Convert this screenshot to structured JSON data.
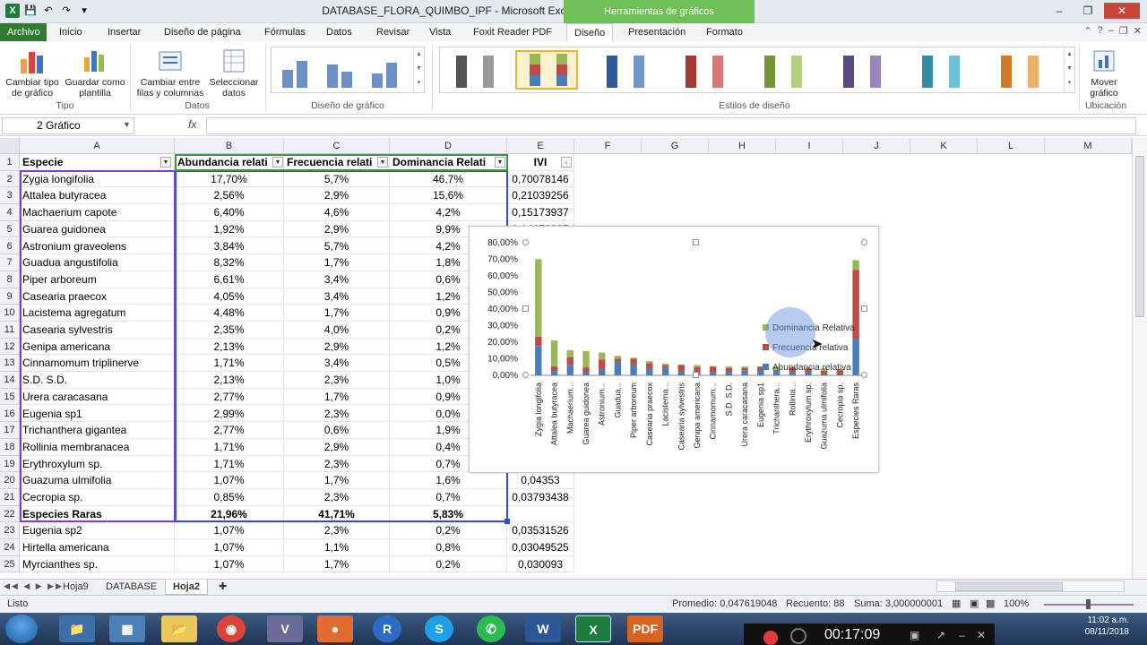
{
  "window": {
    "title": "DATABASE_FLORA_QUIMBO_IPF - Microsoft Excel",
    "tools_banner": "Herramientas de gráficos"
  },
  "ribbon_tabs": [
    "Archivo",
    "Inicio",
    "Insertar",
    "Diseño de página",
    "Fórmulas",
    "Datos",
    "Revisar",
    "Vista",
    "Foxit Reader PDF",
    "Diseño",
    "Presentación",
    "Formato"
  ],
  "ribbon": {
    "cambiar_tipo": "Cambiar tipo de gráfico",
    "guardar_plantilla": "Guardar como plantilla",
    "grupo_tipo": "Tipo",
    "cambiar_filas": "Cambiar entre filas y columnas",
    "seleccionar_datos": "Seleccionar datos",
    "grupo_datos": "Datos",
    "grupo_diseno": "Diseño de gráfico",
    "grupo_estilos": "Estilos de diseño",
    "mover_grafico": "Mover gráfico",
    "grupo_ubicacion": "Ubicación"
  },
  "formula_bar": {
    "name_box": "2 Gráfico",
    "fx": "fx",
    "value": ""
  },
  "columns": [
    "A",
    "B",
    "C",
    "D",
    "E",
    "F",
    "G",
    "H",
    "I",
    "J",
    "K",
    "L",
    "M"
  ],
  "headers": {
    "a": "Especie",
    "b": "Abundancia relati",
    "c": "Frecuencia relati",
    "d": "Dominancia Relati",
    "e": "IVI"
  },
  "rows": [
    {
      "n": "2",
      "a": "Zygia longifolia",
      "b": "17,70%",
      "c": "5,7%",
      "d": "46,7%",
      "e": "0,70078146"
    },
    {
      "n": "3",
      "a": "Attalea butyracea",
      "b": "2,56%",
      "c": "2,9%",
      "d": "15,6%",
      "e": "0,21039256"
    },
    {
      "n": "4",
      "a": "Machaerium capote",
      "b": "6,40%",
      "c": "4,6%",
      "d": "4,2%",
      "e": "0,15173937"
    },
    {
      "n": "5",
      "a": "Guarea guidonea",
      "b": "1,92%",
      "c": "2,9%",
      "d": "9,9%",
      "e": "0,14672987"
    },
    {
      "n": "6",
      "a": "Astronium graveolens",
      "b": "3,84%",
      "c": "5,7%",
      "d": "4,2%",
      "e": ""
    },
    {
      "n": "7",
      "a": "Guadua angustifolia",
      "b": "8,32%",
      "c": "1,7%",
      "d": "1,8%",
      "e": ""
    },
    {
      "n": "8",
      "a": "Piper arboreum",
      "b": "6,61%",
      "c": "3,4%",
      "d": "0,6%",
      "e": ""
    },
    {
      "n": "9",
      "a": "Casearia praecox",
      "b": "4,05%",
      "c": "3,4%",
      "d": "1,2%",
      "e": ""
    },
    {
      "n": "10",
      "a": "Lacistema agregatum",
      "b": "4,48%",
      "c": "1,7%",
      "d": "0,9%",
      "e": ""
    },
    {
      "n": "11",
      "a": "Casearia sylvestris",
      "b": "2,35%",
      "c": "4,0%",
      "d": "0,2%",
      "e": ""
    },
    {
      "n": "12",
      "a": "Genipa americana",
      "b": "2,13%",
      "c": "2,9%",
      "d": "1,2%",
      "e": ""
    },
    {
      "n": "13",
      "a": "Cinnamomum triplinerve",
      "b": "1,71%",
      "c": "3,4%",
      "d": "0,5%",
      "e": ""
    },
    {
      "n": "14",
      "a": "S.D. S.D.",
      "b": "2,13%",
      "c": "2,3%",
      "d": "1,0%",
      "e": ""
    },
    {
      "n": "15",
      "a": "Urera caracasana",
      "b": "2,77%",
      "c": "1,7%",
      "d": "0,9%",
      "e": ""
    },
    {
      "n": "16",
      "a": "Eugenia sp1",
      "b": "2,99%",
      "c": "2,3%",
      "d": "0,0%",
      "e": ""
    },
    {
      "n": "17",
      "a": "Trichanthera gigantea",
      "b": "2,77%",
      "c": "0,6%",
      "d": "1,9%",
      "e": ""
    },
    {
      "n": "18",
      "a": "Rollinia membranacea",
      "b": "1,71%",
      "c": "2,9%",
      "d": "0,4%",
      "e": ""
    },
    {
      "n": "19",
      "a": "Erythroxylum sp.",
      "b": "1,71%",
      "c": "2,3%",
      "d": "0,7%",
      "e": ""
    },
    {
      "n": "20",
      "a": "Guazuma ulmifolia",
      "b": "1,07%",
      "c": "1,7%",
      "d": "1,6%",
      "e": "0,04353"
    },
    {
      "n": "21",
      "a": "Cecropia sp.",
      "b": "0,85%",
      "c": "2,3%",
      "d": "0,7%",
      "e": "0,03793438"
    },
    {
      "n": "22",
      "a": "Especies Raras",
      "b": "21,96%",
      "c": "41,71%",
      "d": "5,83%",
      "e": "",
      "bold": true
    },
    {
      "n": "23",
      "a": "Eugenia sp2",
      "b": "1,07%",
      "c": "2,3%",
      "d": "0,2%",
      "e": "0,03531526"
    },
    {
      "n": "24",
      "a": "Hirtella americana",
      "b": "1,07%",
      "c": "1,1%",
      "d": "0,8%",
      "e": "0,03049525"
    },
    {
      "n": "25",
      "a": "Myrcianthes sp.",
      "b": "1,07%",
      "c": "1,7%",
      "d": "0,2%",
      "e": "0,030093"
    }
  ],
  "chart_data": {
    "type": "bar",
    "stacked": true,
    "categories": [
      "Zygia longifolia",
      "Attalea butyracea",
      "Machaerium...",
      "Guarea guidonea",
      "Astronium...",
      "Guadua...",
      "Piper arboreum",
      "Casearia praecox",
      "Lacistema...",
      "Casearia sylvestris",
      "Genipa americana",
      "Cinnamomum...",
      "S.D. S.D.",
      "Urera caracasana",
      "Eugenia sp1",
      "Trichanthera...",
      "Rollinia...",
      "Erythroxylum sp.",
      "Guazuma ulmifolia",
      "Cecropia sp.",
      "Especies Raras"
    ],
    "series": [
      {
        "name": "Abundancia relativa",
        "color": "#4a7ebb",
        "values": [
          17.7,
          2.56,
          6.4,
          1.92,
          3.84,
          8.32,
          6.61,
          4.05,
          4.48,
          2.35,
          2.13,
          1.71,
          2.13,
          2.77,
          2.99,
          2.77,
          1.71,
          1.71,
          1.07,
          0.85,
          21.96
        ]
      },
      {
        "name": "Frecuencia relativa",
        "color": "#be4b48",
        "values": [
          5.7,
          2.9,
          4.6,
          2.9,
          5.7,
          1.7,
          3.4,
          3.4,
          1.7,
          4.0,
          2.9,
          3.4,
          2.3,
          1.7,
          2.3,
          0.6,
          2.9,
          2.3,
          1.7,
          2.3,
          41.71
        ]
      },
      {
        "name": "Dominancia Relativa",
        "color": "#98b954",
        "values": [
          46.7,
          15.6,
          4.2,
          9.9,
          4.2,
          1.8,
          0.6,
          1.2,
          0.9,
          0.2,
          1.2,
          0.5,
          1.0,
          0.9,
          0.0,
          1.9,
          0.4,
          0.7,
          1.6,
          0.7,
          5.83
        ]
      }
    ],
    "yticks": [
      "0,00%",
      "10,00%",
      "20,00%",
      "30,00%",
      "40,00%",
      "50,00%",
      "60,00%",
      "70,00%",
      "80,00%"
    ],
    "ylim": [
      0,
      80
    ],
    "legend": [
      "Dominancia Relativa",
      "Frecuencia relativa",
      "Abundancia relativa"
    ],
    "legend_position": "right"
  },
  "sheets": [
    "Hoja9",
    "DATABASE",
    "Hoja2"
  ],
  "status": {
    "ready": "Listo",
    "promedio": "Promedio: 0,047619048",
    "recuento": "Recuento: 88",
    "suma": "Suma: 3,000000001",
    "zoom": "100%"
  },
  "recording": {
    "time": "00:17:09"
  },
  "clock": {
    "time": "11:02 a.m.",
    "date": "08/11/2018"
  }
}
